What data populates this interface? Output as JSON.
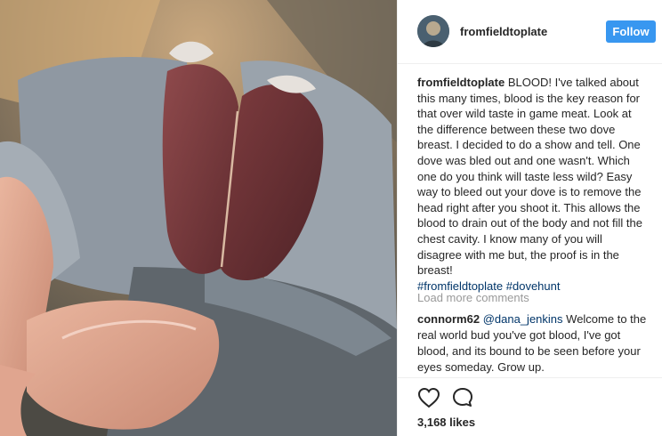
{
  "post": {
    "username": "fromfieldtoplate",
    "follow_label": "Follow",
    "caption_user": "fromfieldtoplate",
    "caption_text": "BLOOD! I've talked about this many times, blood is the key reason for that over wild taste in game meat. Look at the difference between these two dove breast. I decided to do a show and tell. One dove was bled out and one wasn't. Which one do you think will taste less wild? Easy way to bleed out your dove is to remove the head right after you shoot it. This allows the blood to drain out of the body and not fill the chest cavity. I know many of you will disagree with me but, the proof is in the breast!",
    "hashtags": [
      "#fromfieldtoplate",
      "#dovehunt"
    ],
    "load_more": "Load more comments",
    "comment": {
      "user": "connorm62",
      "mention": "@dana_jenkins",
      "text": "Welcome to the real world bud you've got blood, I've got blood, and its bound to be seen before your eyes someday. Grow up."
    },
    "likes": "3,168 likes"
  },
  "icons": {
    "like": "heart-icon",
    "comment": "comment-bubble-icon"
  },
  "colors": {
    "follow_bg": "#3897f0",
    "link": "#003569",
    "muted": "#999999"
  }
}
